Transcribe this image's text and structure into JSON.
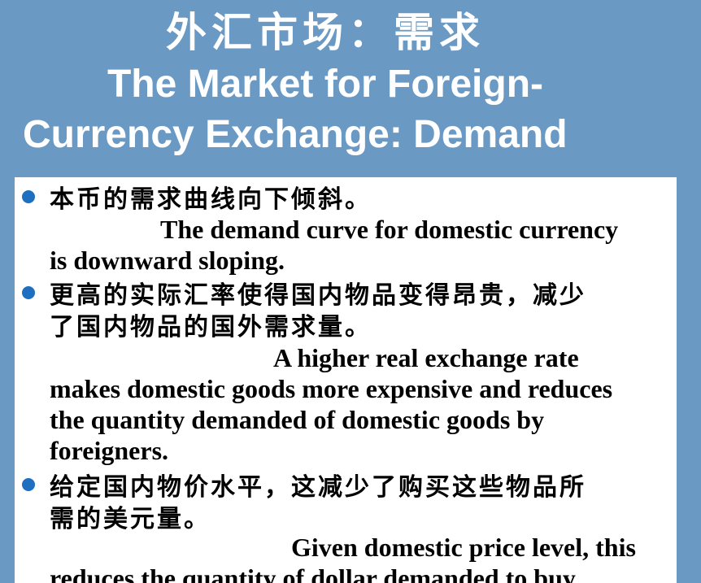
{
  "slide": {
    "title_cn": "外汇市场：需求",
    "title_en_line1": "The Market for Foreign-",
    "title_en_line2": "Currency Exchange: Demand",
    "bullets": [
      {
        "cn_lines": [
          "本币的需求曲线向下倾斜。"
        ],
        "en_lines": [
          "The demand curve for domestic currency",
          "is downward sloping."
        ]
      },
      {
        "cn_lines": [
          "更高的实际汇率使得国内物品变得昂贵，减少",
          "了国内物品的国外需求量。"
        ],
        "en_lines": [
          "A higher real exchange rate",
          "makes domestic goods more expensive and reduces",
          "the quantity demanded of domestic goods by",
          "foreigners."
        ]
      },
      {
        "cn_lines": [
          "给定国内物价水平，这减少了购买这些物品所",
          "需的美元量。"
        ],
        "en_lines": [
          "Given domestic price level, this",
          "reduces the quantity of dollar demanded to buy"
        ]
      }
    ]
  },
  "colors": {
    "background": "#6a99c4",
    "panel": "#ffffff",
    "bullet": "#1e6fc0",
    "title_text": "#ffffff",
    "body_text": "#000000"
  }
}
